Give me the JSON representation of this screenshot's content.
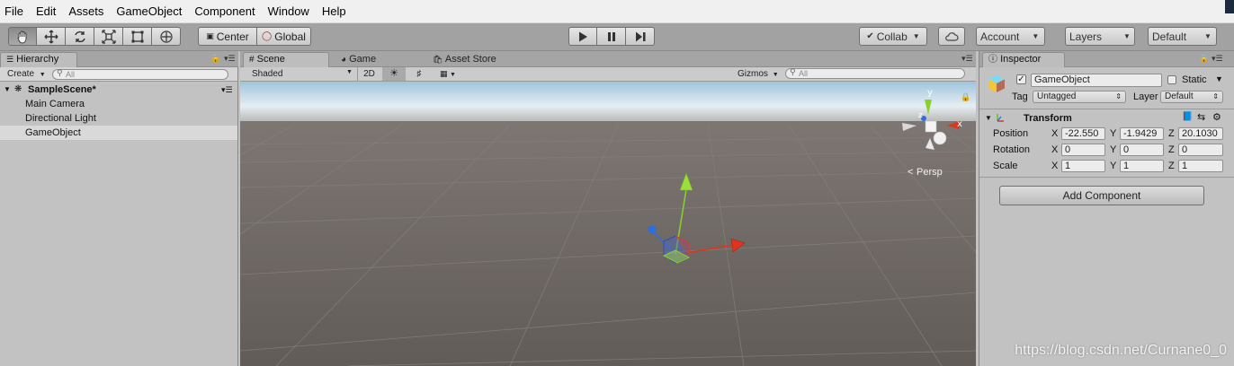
{
  "menu": [
    "File",
    "Edit",
    "Assets",
    "GameObject",
    "Component",
    "Window",
    "Help"
  ],
  "toolbar": {
    "pivot_label": "Center",
    "space_label": "Global",
    "collab_label": "Collab",
    "account_label": "Account",
    "layers_label": "Layers",
    "layout_label": "Default"
  },
  "hierarchy": {
    "tab_label": "Hierarchy",
    "create_label": "Create",
    "search_placeholder": "All",
    "scene_name": "SampleScene*",
    "items": [
      "Main Camera",
      "Directional Light",
      "GameObject"
    ]
  },
  "scene": {
    "tabs": [
      "Scene",
      "Game",
      "Asset Store"
    ],
    "shading_mode": "Shaded",
    "mode_2d": "2D",
    "gizmos_label": "Gizmos",
    "search_placeholder": "All",
    "projection_label": "Persp",
    "gizmo_axes": {
      "y": "y",
      "x": "x",
      "z": "z"
    }
  },
  "inspector": {
    "tab_label": "Inspector",
    "object_name": "GameObject",
    "static_label": "Static",
    "tag_label": "Tag",
    "tag_value": "Untagged",
    "layer_label": "Layer",
    "layer_value": "Default",
    "component_title": "Transform",
    "rows": [
      {
        "label": "Position",
        "x": "-22.550",
        "y": "-1.9429",
        "z": "20.1030"
      },
      {
        "label": "Rotation",
        "x": "0",
        "y": "0",
        "z": "0"
      },
      {
        "label": "Scale",
        "x": "1",
        "y": "1",
        "z": "1"
      }
    ],
    "axis_labels": {
      "x": "X",
      "y": "Y",
      "z": "Z"
    },
    "add_component_label": "Add Component"
  },
  "watermark": "https://blog.csdn.net/Curnane0_0",
  "colors": {
    "x_axis": "#e0341e",
    "y_axis": "#8ad22a",
    "z_axis": "#2b6ee0",
    "panel_bg": "#c2c2c2",
    "toolbar_bg": "#a2a2a2"
  }
}
